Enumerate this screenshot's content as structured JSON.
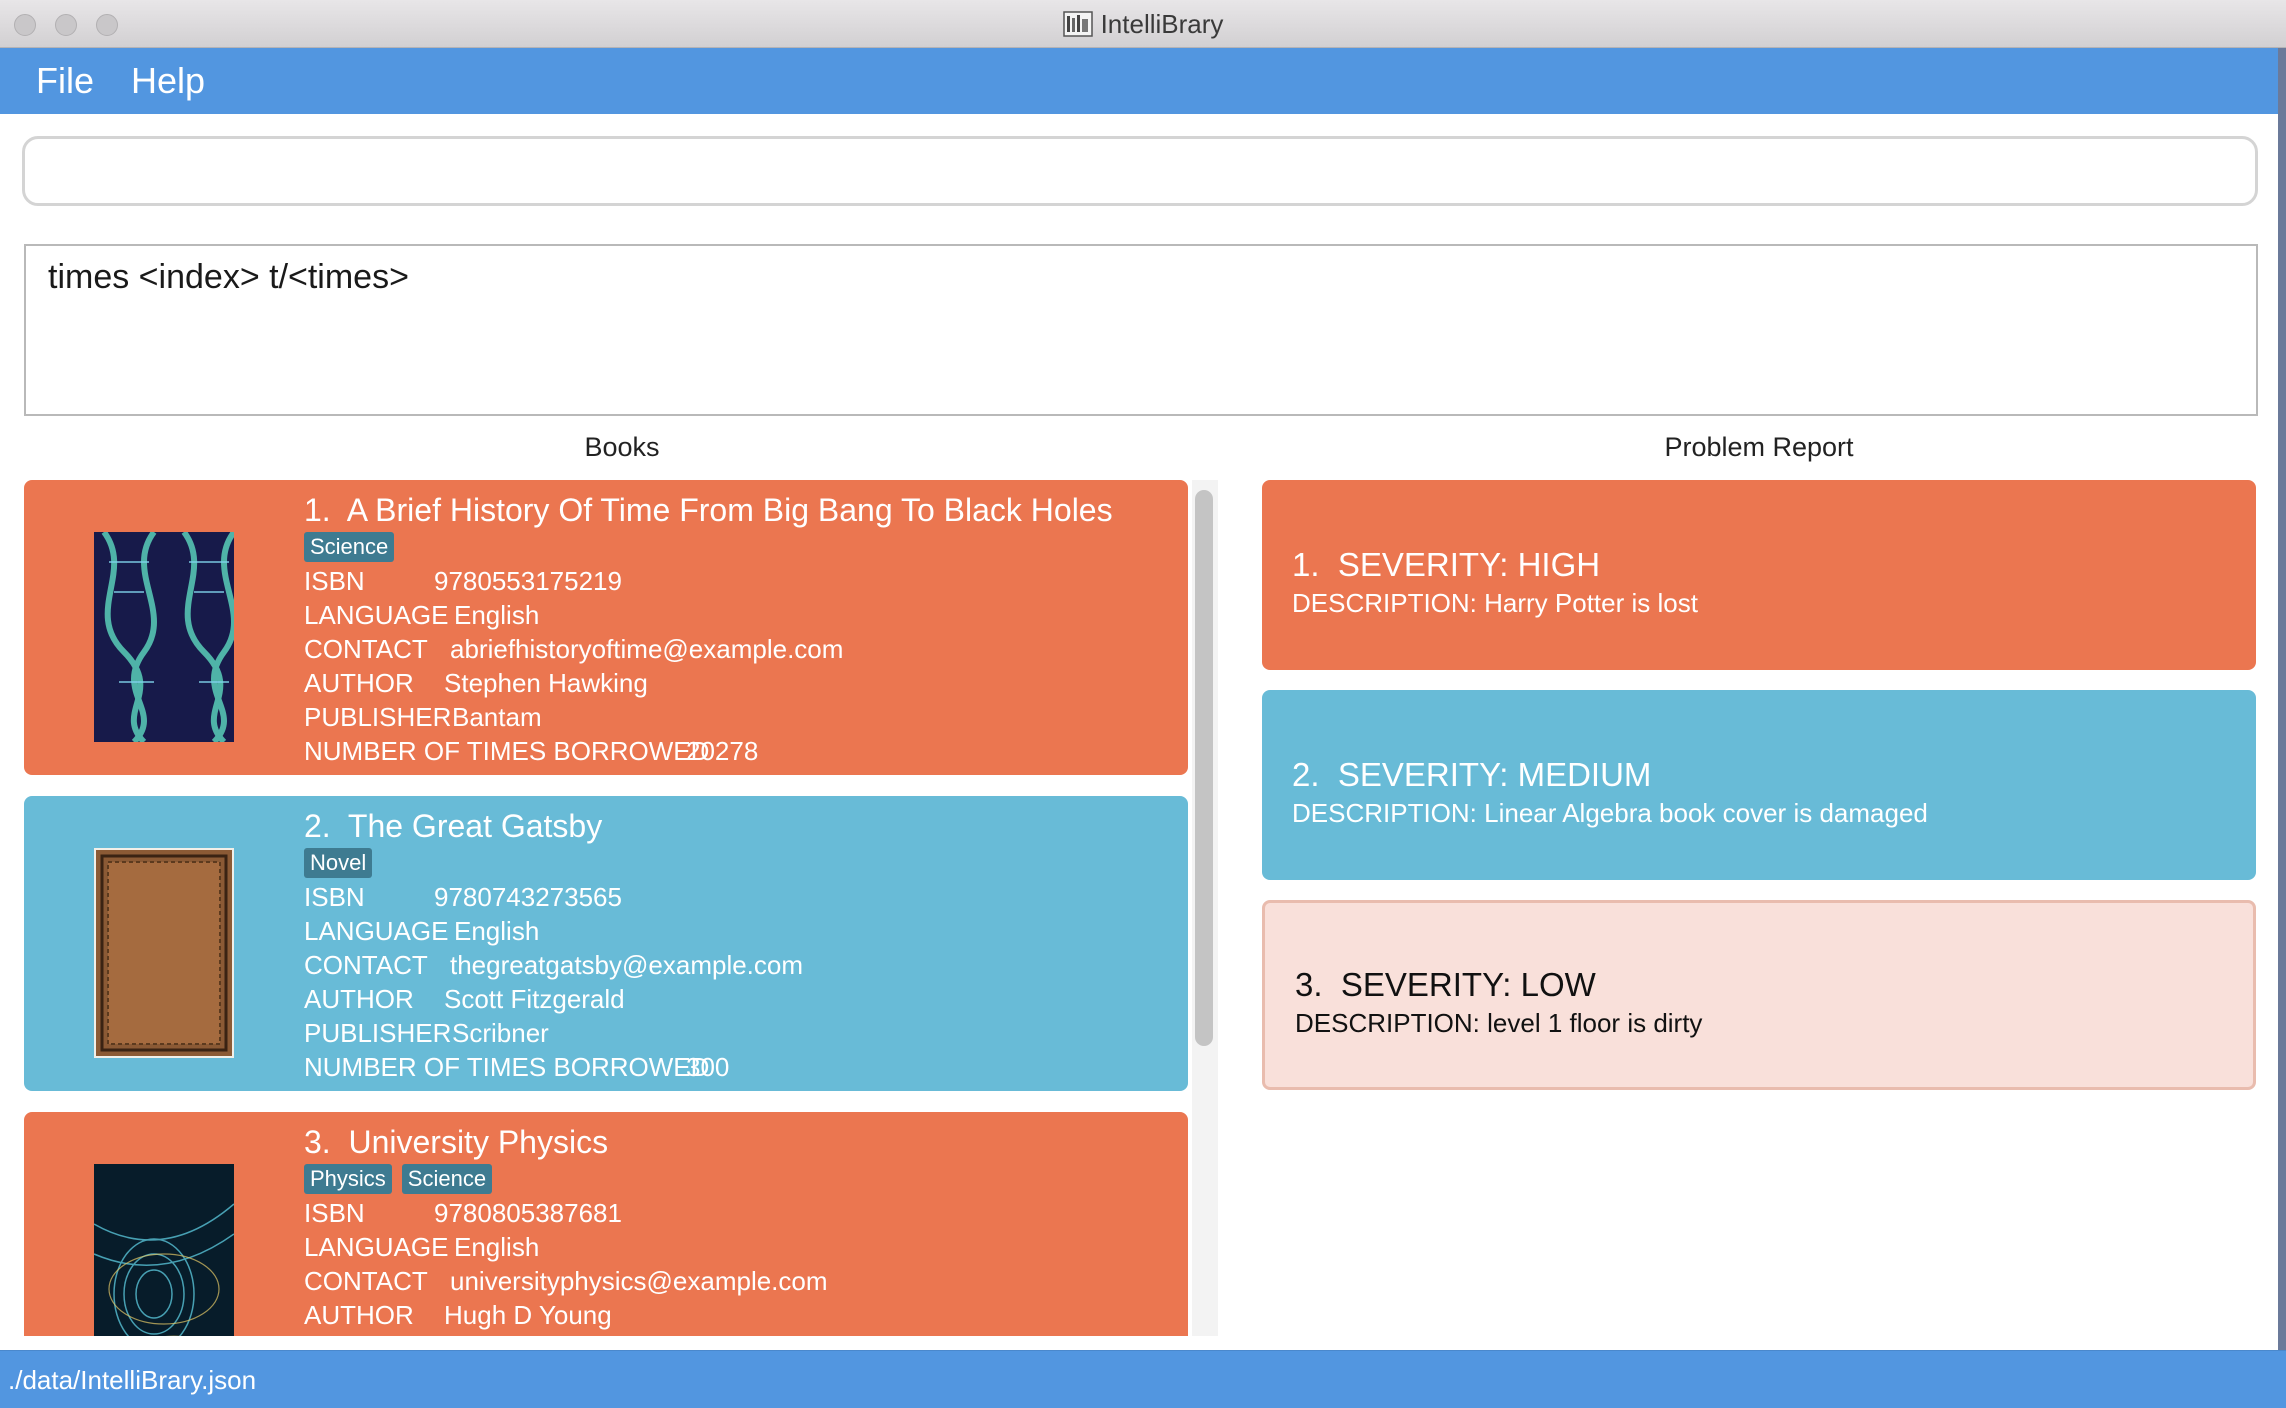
{
  "window": {
    "title": "IntelliBrary"
  },
  "menu": {
    "file": "File",
    "help": "Help"
  },
  "command": {
    "value": ""
  },
  "result": {
    "text": "times <index> t/<times>"
  },
  "books_panel": {
    "title": "Books"
  },
  "problems_panel": {
    "title": "Problem Report"
  },
  "field_labels": {
    "isbn": "ISBN",
    "language": "LANGUAGE",
    "contact": "CONTACT",
    "author": "AUTHOR",
    "publisher": "PUBLISHER",
    "borrowed": "NUMBER OF TIMES BORROWED"
  },
  "books": [
    {
      "index": "1.",
      "title": "A Brief History Of Time From Big Bang To Black Holes",
      "tags": [
        "Science"
      ],
      "isbn": "9780553175219",
      "language": "English",
      "contact": "abriefhistoryoftime@example.com",
      "author": "Stephen Hawking",
      "publisher": "Bantam",
      "times_borrowed": "20278",
      "color": "#eb7650",
      "cover_icon": "dna-helix-cover"
    },
    {
      "index": "2.",
      "title": "The Great Gatsby",
      "tags": [
        "Novel"
      ],
      "isbn": "9780743273565",
      "language": "English",
      "contact": "thegreatgatsby@example.com",
      "author": "Scott Fitzgerald",
      "publisher": "Scribner",
      "times_borrowed": "300",
      "color": "#68bbd7",
      "cover_icon": "leather-book-cover"
    },
    {
      "index": "3.",
      "title": "University Physics",
      "tags": [
        "Physics",
        "Science"
      ],
      "isbn": "9780805387681",
      "language": "English",
      "contact": "universityphysics@example.com",
      "author": "Hugh D Young",
      "color": "#eb7650",
      "cover_icon": "physics-swirl-cover"
    }
  ],
  "problems": [
    {
      "index": "1.",
      "severity": "SEVERITY: HIGH",
      "description": "DESCRIPTION: Harry Potter is lost",
      "color": "#eb7650"
    },
    {
      "index": "2.",
      "severity": "SEVERITY: MEDIUM",
      "description": "DESCRIPTION: Linear Algebra book cover is damaged",
      "color": "#68bbd7"
    },
    {
      "index": "3.",
      "severity": "SEVERITY: LOW",
      "description": "DESCRIPTION: level 1 floor is dirty",
      "color": "#f9e0da"
    }
  ],
  "status": {
    "path": "./data/IntelliBrary.json"
  }
}
